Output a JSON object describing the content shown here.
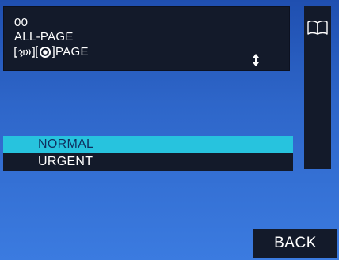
{
  "info": {
    "id": "00",
    "group": "ALL-PAGE",
    "mode_suffix": "PAGE",
    "mode_icons": [
      "speaker-page-icon",
      "ring-target-icon"
    ]
  },
  "sidebar": {
    "icon": "book-icon"
  },
  "priority": {
    "items": [
      {
        "label": "NORMAL",
        "selected": true
      },
      {
        "label": "URGENT",
        "selected": false
      }
    ]
  },
  "footer": {
    "back_label": "BACK"
  },
  "colors": {
    "background_top": "#1f4fb0",
    "background_bottom": "#3b7be0",
    "panel": "#131a2a",
    "highlight": "#27c3de",
    "highlight_text": "#0f2f5e",
    "text": "#ffffff"
  }
}
